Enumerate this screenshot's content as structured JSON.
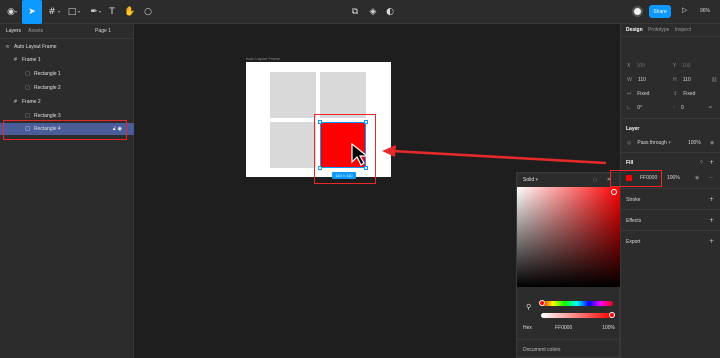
{
  "toolbar": {
    "share_label": "Share",
    "zoom_label": "96%"
  },
  "left_panel": {
    "tab_layers": "Layers",
    "tab_assets": "Assets",
    "page_selector": "Page 1",
    "layers": [
      {
        "label": "Auto Layout Frame"
      },
      {
        "label": "Frame 1"
      },
      {
        "label": "Rectangle 1"
      },
      {
        "label": "Rectangle 2"
      },
      {
        "label": "Frame 2"
      },
      {
        "label": "Rectangle 3"
      },
      {
        "label": "Rectangle 4"
      }
    ]
  },
  "canvas": {
    "frame_label": "Auto Layout Frame",
    "size_badge": "110 × 110",
    "selected_fill": "#ff0000"
  },
  "color_picker": {
    "fill_type": "Solid",
    "mode": "Hex",
    "hex_value": "FF0000",
    "opacity": "100%",
    "document_colors": "Document colors"
  },
  "right_panel": {
    "tab_design": "Design",
    "tab_prototype": "Prototype",
    "tab_inspect": "Inspect",
    "x_value": "100",
    "y_value": "100",
    "w_value": "110",
    "h_value": "110",
    "w_mode": "Fixed",
    "h_mode": "Fixed",
    "rotation": "0°",
    "radius": "0",
    "layer_title": "Layer",
    "blend_mode": "Pass through",
    "layer_opacity": "100%",
    "fill_title": "Fill",
    "fill_hex": "FF0000",
    "fill_opacity": "100%",
    "stroke_title": "Stroke",
    "effects_title": "Effects",
    "export_title": "Export"
  },
  "colors": {
    "accent": "#0d99ff",
    "highlight": "#e8292a",
    "selection_row": "#4a5d99"
  }
}
